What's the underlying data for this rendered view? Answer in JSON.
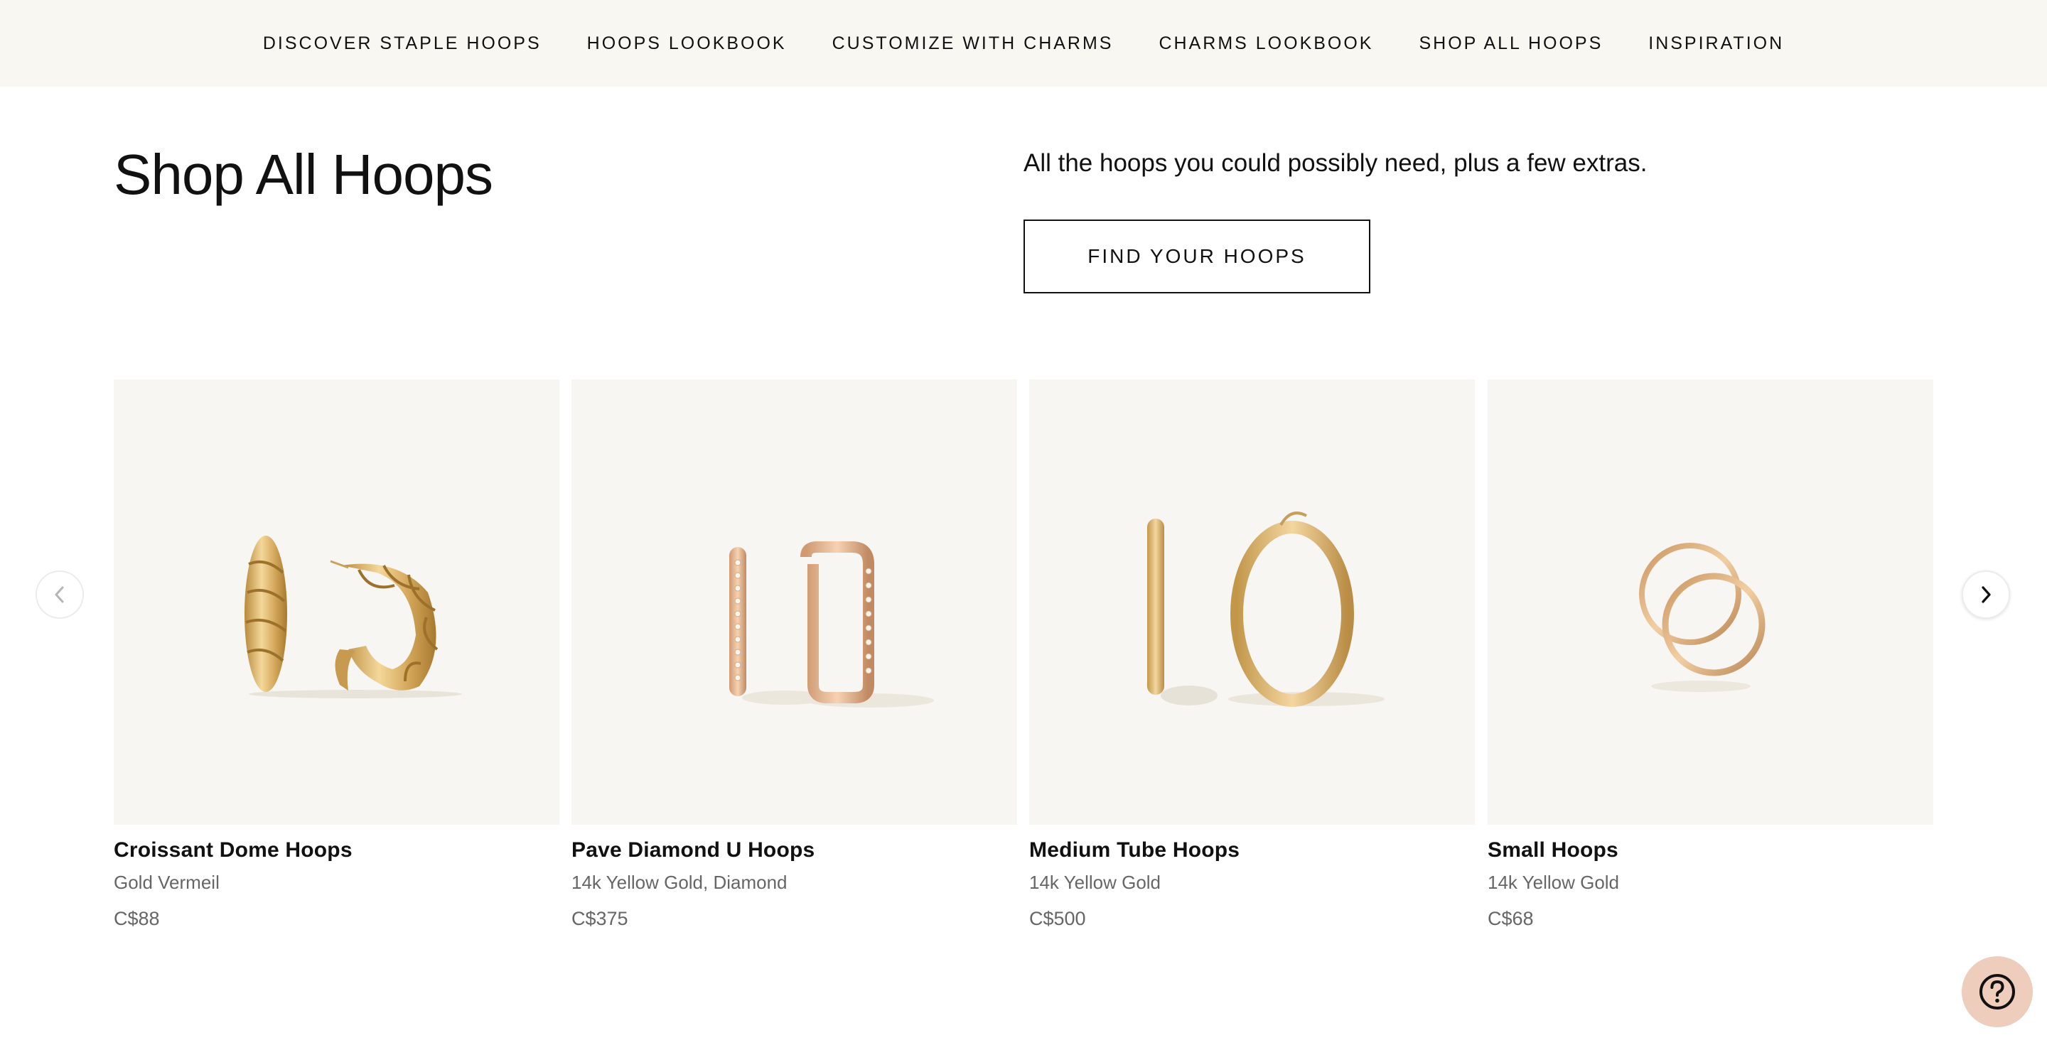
{
  "nav": {
    "items": [
      {
        "label": "DISCOVER STAPLE HOOPS"
      },
      {
        "label": "HOOPS LOOKBOOK"
      },
      {
        "label": "CUSTOMIZE WITH CHARMS"
      },
      {
        "label": "CHARMS LOOKBOOK"
      },
      {
        "label": "SHOP ALL HOOPS"
      },
      {
        "label": "INSPIRATION"
      }
    ]
  },
  "header": {
    "title": "Shop All Hoops",
    "tagline": "All the hoops you could possibly need, plus a few extras.",
    "cta_label": "FIND YOUR HOOPS"
  },
  "carousel": {
    "prev_icon": "chevron-left-icon",
    "next_icon": "chevron-right-icon",
    "products": [
      {
        "name": "Croissant Dome Hoops",
        "material": "Gold Vermeil",
        "price": "C$88",
        "image": "croissant-dome-hoops-image"
      },
      {
        "name": "Pave Diamond U Hoops",
        "material": "14k Yellow Gold, Diamond",
        "price": "C$375",
        "image": "pave-diamond-u-hoops-image"
      },
      {
        "name": "Medium Tube Hoops",
        "material": "14k Yellow Gold",
        "price": "C$500",
        "image": "medium-tube-hoops-image"
      },
      {
        "name": "Small Hoops",
        "material": "14k Yellow Gold",
        "price": "C$68",
        "image": "small-hoops-image"
      }
    ]
  },
  "help": {
    "icon": "question-mark-icon"
  },
  "colors": {
    "nav_background": "#f9f7f2",
    "card_background": "#f8f6f2",
    "gold": "#d9b06a",
    "rose_gold": "#e2b48f",
    "help_button": "#eecdbd",
    "muted_text": "#666666"
  }
}
